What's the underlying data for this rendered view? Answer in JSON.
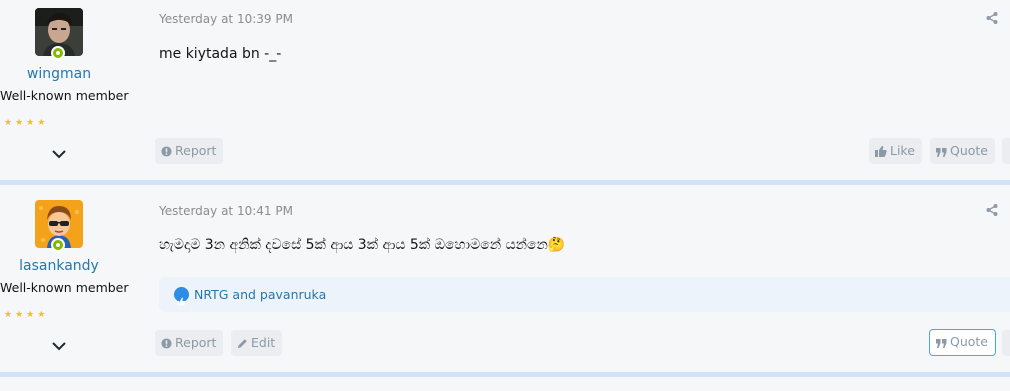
{
  "posts": [
    {
      "username": "wingman",
      "user_title": "Well-known member",
      "stars": "★★★★",
      "time": "Yesterday at 10:39 PM",
      "message": "me kiytada bn -_-",
      "actions": {
        "report": "Report",
        "like": "Like",
        "quote": "Quote"
      }
    },
    {
      "username": "lasankandy",
      "user_title": "Well-known member",
      "stars": "★★★★",
      "time": "Yesterday at 10:41 PM",
      "message": "හැමදාම 3න අනික් දවසේ 5ක් ආය 3ක් ආය 5ක් ඔහොමනේ යන්නෙ",
      "message_emoji": "🤔",
      "reactions_text": "NRTG and pavanruka",
      "actions": {
        "report": "Report",
        "edit": "Edit",
        "quote": "Quote"
      }
    }
  ],
  "colors": {
    "link": "#2577b1",
    "separator": "#d3e3f5",
    "online": "#7fb900",
    "reaction": "#2f8be8"
  },
  "icons": [
    "chevron-down-icon",
    "share-icon",
    "report-icon",
    "like-icon",
    "quote-icon",
    "edit-icon",
    "online-status-icon"
  ]
}
